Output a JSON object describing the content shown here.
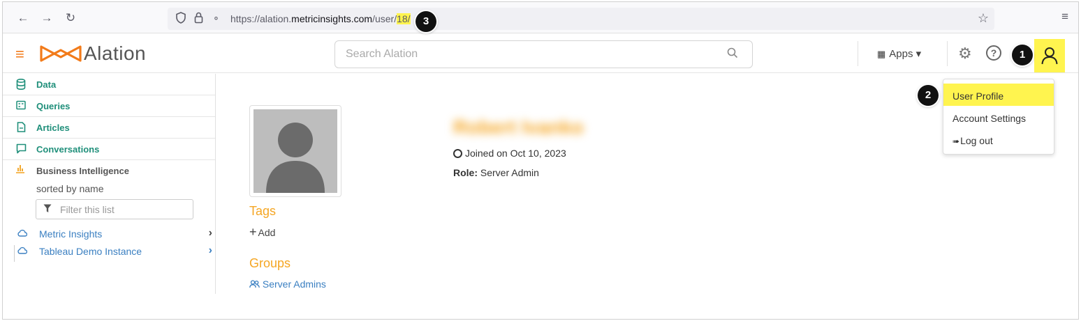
{
  "browser": {
    "url_prefix": "https://alation.",
    "url_host": "metricinsights.com",
    "url_path": "/user/",
    "url_highlight": "18/"
  },
  "header": {
    "logo_text": "Alation",
    "search_placeholder": "Search Alation",
    "apps_label": "Apps",
    "help_label": "?"
  },
  "sidebar": {
    "items": [
      {
        "label": "Data",
        "icon": "database-icon"
      },
      {
        "label": "Queries",
        "icon": "query-icon"
      },
      {
        "label": "Articles",
        "icon": "article-icon"
      },
      {
        "label": "Conversations",
        "icon": "conversation-icon"
      }
    ],
    "bi_title": "Business Intelligence",
    "sorted_by": "sorted by name",
    "filter_placeholder": "Filter this list",
    "sources": [
      {
        "label": "Metric Insights"
      },
      {
        "label": "Tableau Demo Instance"
      }
    ]
  },
  "profile": {
    "name": "Robert Ivanko",
    "joined": "Joined on Oct 10, 2023",
    "role_label": "Role:",
    "role_value": "Server Admin",
    "tags_title": "Tags",
    "add_label": "Add",
    "groups_title": "Groups",
    "group_name": "Server Admins"
  },
  "user_menu": {
    "items": [
      "User Profile",
      "Account Settings",
      "Log out"
    ]
  },
  "callouts": [
    "1",
    "2",
    "3"
  ],
  "colors": {
    "brand_orange": "#f27b1a",
    "teal": "#1f8f7a",
    "link_blue": "#3a7fc1",
    "highlight": "#fff44f",
    "section_orange": "#f5a623"
  }
}
